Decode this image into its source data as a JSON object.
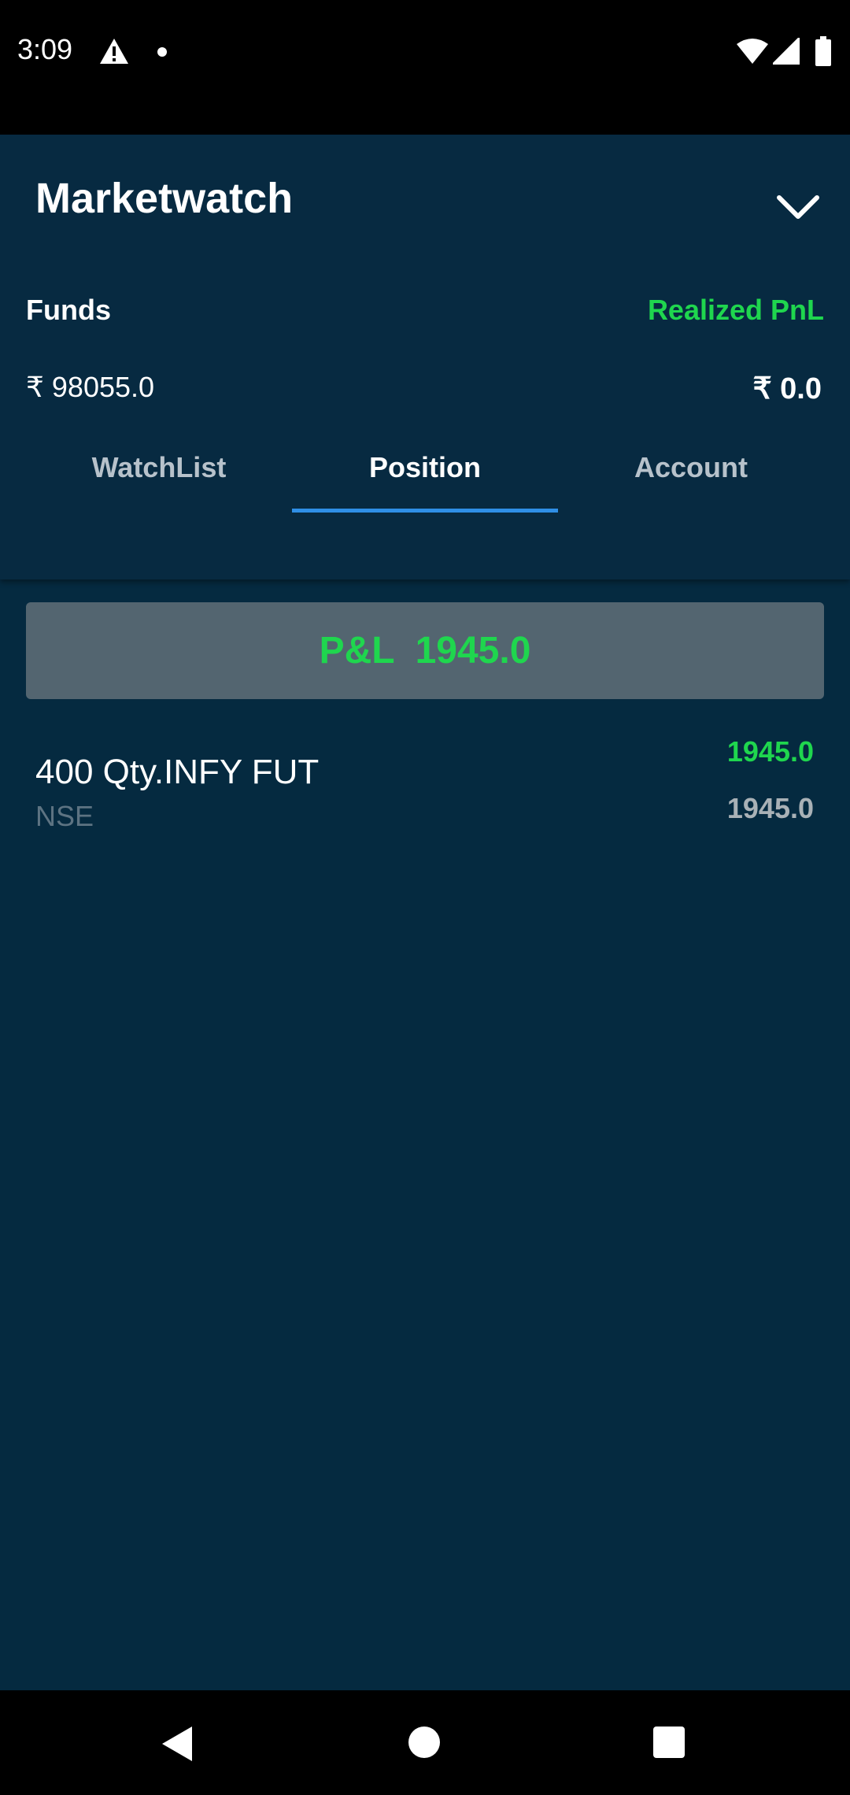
{
  "status_bar": {
    "time": "3:09",
    "icons": [
      "warning-icon",
      "notification-dot-icon",
      "wifi-icon",
      "signal-icon",
      "battery-icon"
    ]
  },
  "header": {
    "title": "Marketwatch",
    "funds_label": "Funds",
    "funds_value": "₹ 98055.0",
    "realized_pnl_label": "Realized PnL",
    "realized_pnl_value": "₹ 0.0"
  },
  "tabs": [
    {
      "label": "WatchList",
      "active": false
    },
    {
      "label": "Position",
      "active": true
    },
    {
      "label": "Account",
      "active": false
    }
  ],
  "summary": {
    "pnl_label": "P&L",
    "pnl_value": "1945.0"
  },
  "positions": [
    {
      "name": "400 Qty.INFY FUT",
      "exchange": "NSE",
      "pnl": "1945.0",
      "value": "1945.0"
    }
  ],
  "colors": {
    "background": "#052a40",
    "profit_green": "#1fd64e",
    "tab_indicator": "#2f8fe6",
    "pnl_box": "#536570"
  }
}
